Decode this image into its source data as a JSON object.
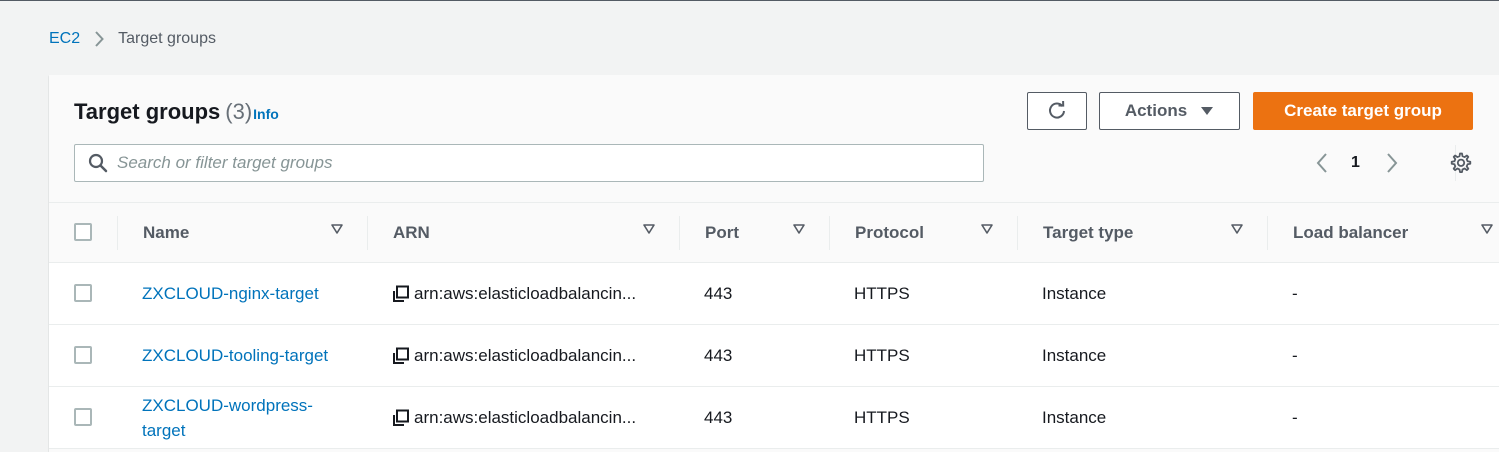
{
  "breadcrumb": {
    "root": "EC2",
    "current": "Target groups"
  },
  "header": {
    "title": "Target groups",
    "count": "(3)",
    "info": "Info"
  },
  "toolbar": {
    "refresh_icon": "refresh-icon",
    "actions_label": "Actions",
    "create_label": "Create target group"
  },
  "search": {
    "placeholder": "Search or filter target groups",
    "value": ""
  },
  "pagination": {
    "current_page": "1"
  },
  "colors": {
    "primary_button": "#ec7211",
    "link": "#0073bb"
  },
  "table": {
    "columns": [
      "Name",
      "ARN",
      "Port",
      "Protocol",
      "Target type",
      "Load balancer"
    ],
    "rows": [
      {
        "name": "ZXCLOUD-nginx-target",
        "arn": "arn:aws:elasticloadbalancin...",
        "port": "443",
        "protocol": "HTTPS",
        "target_type": "Instance",
        "load_balancer": "-"
      },
      {
        "name": "ZXCLOUD-tooling-target",
        "arn": "arn:aws:elasticloadbalancin...",
        "port": "443",
        "protocol": "HTTPS",
        "target_type": "Instance",
        "load_balancer": "-"
      },
      {
        "name": "ZXCLOUD-wordpress-target",
        "name_line1": "ZXCLOUD-wordpress-",
        "name_line2": "target",
        "arn": "arn:aws:elasticloadbalancin...",
        "port": "443",
        "protocol": "HTTPS",
        "target_type": "Instance",
        "load_balancer": "-"
      }
    ]
  }
}
